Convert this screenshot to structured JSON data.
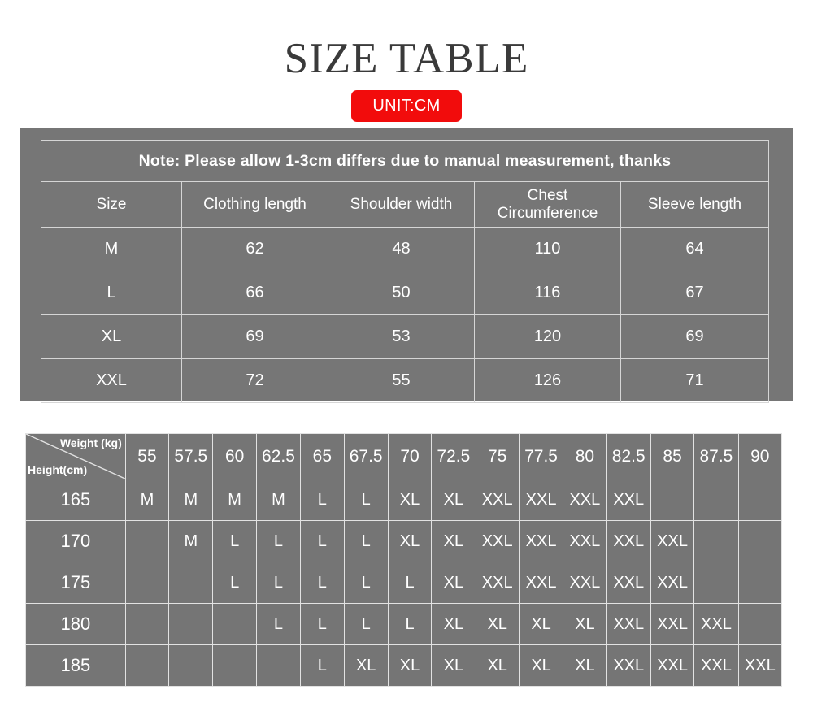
{
  "header": {
    "title": "SIZE TABLE",
    "unit_badge": "UNIT:CM",
    "badge_color": "#f20c0c",
    "title_color": "#3a3a3a"
  },
  "measurement_table": {
    "note": "Note: Please allow 1-3cm differs due to manual measurement, thanks",
    "columns": [
      "Size",
      "Clothing length",
      "Shoulder width",
      "Chest Circumference",
      "Sleeve length"
    ],
    "columns_display": {
      "size": "Size",
      "clothing_length": "Clothing length",
      "shoulder_width": "Shoulder width",
      "chest_circumference_line1": "Chest",
      "chest_circumference_line2": "Circumference",
      "sleeve_length": "Sleeve length"
    },
    "rows": [
      {
        "size": "M",
        "clothing_length": "62",
        "shoulder_width": "48",
        "chest_circumference": "110",
        "sleeve_length": "64"
      },
      {
        "size": "L",
        "clothing_length": "66",
        "shoulder_width": "50",
        "chest_circumference": "116",
        "sleeve_length": "67"
      },
      {
        "size": "XL",
        "clothing_length": "69",
        "shoulder_width": "53",
        "chest_circumference": "120",
        "sleeve_length": "69"
      },
      {
        "size": "XXL",
        "clothing_length": "72",
        "shoulder_width": "55",
        "chest_circumference": "126",
        "sleeve_length": "71"
      }
    ]
  },
  "recommendation_table": {
    "corner_label_weight": "Weight (kg)",
    "corner_label_height": "Height(cm)",
    "weights": [
      "55",
      "57.5",
      "60",
      "62.5",
      "65",
      "67.5",
      "70",
      "72.5",
      "75",
      "77.5",
      "80",
      "82.5",
      "85",
      "87.5",
      "90"
    ],
    "rows": [
      {
        "height": "165",
        "sizes": [
          "M",
          "M",
          "M",
          "M",
          "L",
          "L",
          "XL",
          "XL",
          "XXL",
          "XXL",
          "XXL",
          "XXL",
          "",
          "",
          ""
        ]
      },
      {
        "height": "170",
        "sizes": [
          "",
          "M",
          "L",
          "L",
          "L",
          "L",
          "XL",
          "XL",
          "XXL",
          "XXL",
          "XXL",
          "XXL",
          "XXL",
          "",
          ""
        ]
      },
      {
        "height": "175",
        "sizes": [
          "",
          "",
          "L",
          "L",
          "L",
          "L",
          "L",
          "XL",
          "XXL",
          "XXL",
          "XXL",
          "XXL",
          "XXL",
          "",
          ""
        ]
      },
      {
        "height": "180",
        "sizes": [
          "",
          "",
          "",
          "L",
          "L",
          "L",
          "L",
          "XL",
          "XL",
          "XL",
          "XL",
          "XXL",
          "XXL",
          "XXL",
          ""
        ]
      },
      {
        "height": "185",
        "sizes": [
          "",
          "",
          "",
          "",
          "L",
          "XL",
          "XL",
          "XL",
          "XL",
          "XL",
          "XL",
          "XXL",
          "XXL",
          "XXL",
          "XXL"
        ]
      }
    ]
  }
}
